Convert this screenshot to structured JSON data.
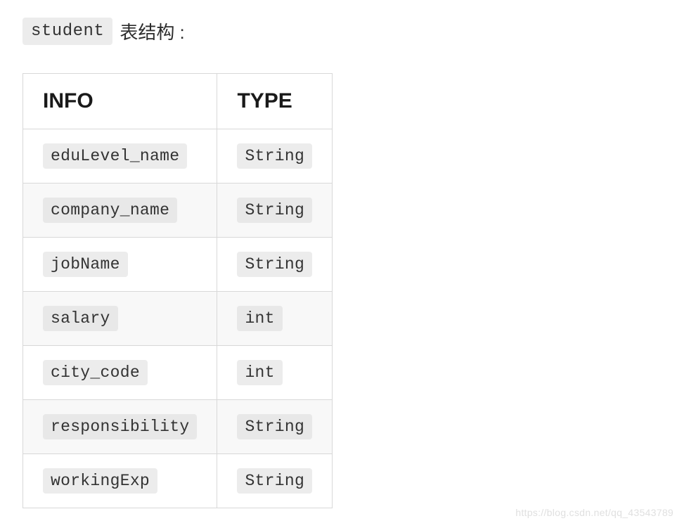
{
  "title": {
    "code_tag": "student",
    "suffix": "表结构 :"
  },
  "table": {
    "headers": {
      "info": "INFO",
      "type": "TYPE"
    },
    "rows": [
      {
        "info": "eduLevel_name",
        "type": "String"
      },
      {
        "info": "company_name",
        "type": "String"
      },
      {
        "info": "jobName",
        "type": "String"
      },
      {
        "info": "salary",
        "type": "int"
      },
      {
        "info": "city_code",
        "type": "int"
      },
      {
        "info": "responsibility",
        "type": "String"
      },
      {
        "info": "workingExp",
        "type": "String"
      }
    ]
  },
  "watermark": "https://blog.csdn.net/qq_43543789"
}
